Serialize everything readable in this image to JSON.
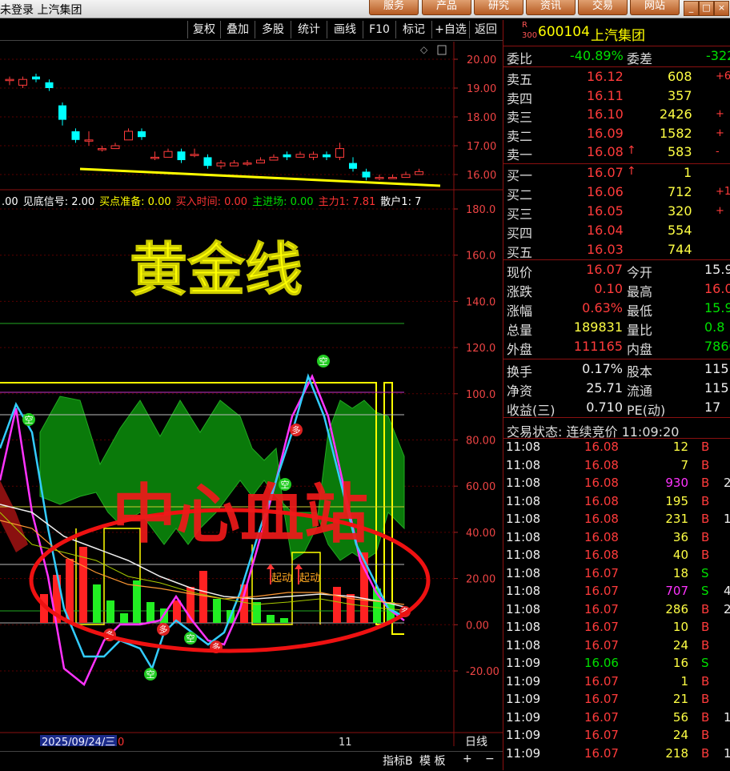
{
  "window": {
    "title": "未登录 上汽集团"
  },
  "menu": [
    "服务",
    "产品",
    "研究",
    "资讯",
    "交易",
    "网站"
  ],
  "win_controls": [
    "_",
    "□",
    "×"
  ],
  "toolbar": [
    "复权",
    "叠加",
    "多股",
    "统计",
    "画线",
    "F10",
    "标记",
    "+自选",
    "返回"
  ],
  "price_axis": [
    "20.00",
    "19.00",
    "18.00",
    "17.00",
    "16.00"
  ],
  "indicator_axis": [
    "180.0",
    "160.0",
    "140.0",
    "120.0",
    "100.0",
    "80.00",
    "60.00",
    "40.00",
    "20.00",
    "0.00",
    "-20.00"
  ],
  "indicator_params": [
    {
      "label": "见底信号: 2.00",
      "color": "#ffffff"
    },
    {
      "label": "买点准备: 0.00",
      "color": "#ffff00"
    },
    {
      "label": "买入时间: 0.00",
      "color": "#ff3333"
    },
    {
      "label": "主进场: 0.00",
      "color": "#00e000"
    },
    {
      "label": "主力1: 7.81",
      "color": "#ff3333"
    },
    {
      "label": "散户1: 7",
      "color": "#ffffff"
    }
  ],
  "indicator_params_prefix": ".00",
  "overlay": {
    "gold_line": "黄金线",
    "center": "中心血站"
  },
  "markers": {
    "kong": "空",
    "duo": "多",
    "qidong": "起动"
  },
  "date_label": "2025/09/24/三",
  "date_tail": "0",
  "axis_tick": "11",
  "period": "日线",
  "bottom_tabs": [
    "指标B",
    "模 板",
    "+",
    "−"
  ],
  "chart_data": {
    "type": "candlestick",
    "ylim": [
      15.5,
      20.5
    ],
    "candles": [
      {
        "o": 19.3,
        "c": 19.3,
        "h": 19.4,
        "l": 19.1
      },
      {
        "o": 19.1,
        "c": 19.3,
        "h": 19.4,
        "l": 19.0
      },
      {
        "o": 19.4,
        "c": 19.3,
        "h": 19.5,
        "l": 19.2
      },
      {
        "o": 19.2,
        "c": 19.0,
        "h": 19.3,
        "l": 18.9
      },
      {
        "o": 18.4,
        "c": 17.9,
        "h": 18.5,
        "l": 17.7
      },
      {
        "o": 17.5,
        "c": 17.2,
        "h": 17.6,
        "l": 17.1
      },
      {
        "o": 17.2,
        "c": 17.2,
        "h": 17.5,
        "l": 17.0
      },
      {
        "o": 16.9,
        "c": 16.9,
        "h": 17.0,
        "l": 16.8
      },
      {
        "o": 16.9,
        "c": 17.0,
        "h": 17.1,
        "l": 16.9
      },
      {
        "o": 17.2,
        "c": 17.5,
        "h": 17.6,
        "l": 17.2
      },
      {
        "o": 17.5,
        "c": 17.3,
        "h": 17.6,
        "l": 17.2
      },
      {
        "o": 16.6,
        "c": 16.6,
        "h": 16.8,
        "l": 16.5
      },
      {
        "o": 16.6,
        "c": 16.8,
        "h": 16.9,
        "l": 16.6
      },
      {
        "o": 16.8,
        "c": 16.5,
        "h": 16.9,
        "l": 16.4
      },
      {
        "o": 16.7,
        "c": 16.7,
        "h": 16.9,
        "l": 16.6
      },
      {
        "o": 16.6,
        "c": 16.3,
        "h": 16.7,
        "l": 16.2
      },
      {
        "o": 16.3,
        "c": 16.4,
        "h": 16.5,
        "l": 16.2
      },
      {
        "o": 16.3,
        "c": 16.4,
        "h": 16.5,
        "l": 16.3
      },
      {
        "o": 16.4,
        "c": 16.4,
        "h": 16.5,
        "l": 16.3
      },
      {
        "o": 16.4,
        "c": 16.5,
        "h": 16.6,
        "l": 16.4
      },
      {
        "o": 16.5,
        "c": 16.6,
        "h": 16.7,
        "l": 16.5
      },
      {
        "o": 16.7,
        "c": 16.6,
        "h": 16.8,
        "l": 16.5
      },
      {
        "o": 16.6,
        "c": 16.7,
        "h": 16.8,
        "l": 16.6
      },
      {
        "o": 16.6,
        "c": 16.7,
        "h": 16.8,
        "l": 16.5
      },
      {
        "o": 16.7,
        "c": 16.6,
        "h": 16.8,
        "l": 16.5
      },
      {
        "o": 16.6,
        "c": 16.9,
        "h": 17.1,
        "l": 16.5
      },
      {
        "o": 16.4,
        "c": 16.2,
        "h": 16.6,
        "l": 16.1
      },
      {
        "o": 16.1,
        "c": 15.9,
        "h": 16.2,
        "l": 15.8
      },
      {
        "o": 15.9,
        "c": 15.9,
        "h": 16.0,
        "l": 15.8
      },
      {
        "o": 15.9,
        "c": 15.9,
        "h": 16.0,
        "l": 15.85
      },
      {
        "o": 15.9,
        "c": 16.0,
        "h": 16.1,
        "l": 15.9
      },
      {
        "o": 16.0,
        "c": 16.1,
        "h": 16.2,
        "l": 16.0
      }
    ],
    "gold_line_value": [
      16.1,
      15.5
    ]
  },
  "stock": {
    "r": "R",
    "market": "300",
    "code": "600104",
    "name": "上汽集团"
  },
  "order_book": {
    "weibi_label": "委比",
    "weibi": "-40.89%",
    "weicha_label": "委差",
    "weicha": "-322",
    "asks": [
      {
        "label": "卖五",
        "price": "16.12",
        "vol": "608",
        "chg": "+6"
      },
      {
        "label": "卖四",
        "price": "16.11",
        "vol": "357",
        "chg": ""
      },
      {
        "label": "卖三",
        "price": "16.10",
        "vol": "2426",
        "chg": "+"
      },
      {
        "label": "卖二",
        "price": "16.09",
        "vol": "1582",
        "chg": "+"
      },
      {
        "label": "卖一",
        "price": "16.08",
        "vol": "583",
        "chg": "-",
        "arrow": "↑"
      }
    ],
    "bids": [
      {
        "label": "买一",
        "price": "16.07",
        "vol": "1",
        "chg": "",
        "arrow": "↑"
      },
      {
        "label": "买二",
        "price": "16.06",
        "vol": "712",
        "chg": "+1"
      },
      {
        "label": "买三",
        "price": "16.05",
        "vol": "320",
        "chg": "+"
      },
      {
        "label": "买四",
        "price": "16.04",
        "vol": "554",
        "chg": ""
      },
      {
        "label": "买五",
        "price": "16.03",
        "vol": "744",
        "chg": ""
      }
    ]
  },
  "quote": {
    "rows": [
      {
        "l1": "现价",
        "v1": "16.07",
        "l2": "今开",
        "v2": "15.9"
      },
      {
        "l1": "涨跌",
        "v1": "0.10",
        "l2": "最高",
        "v2": "16.0"
      },
      {
        "l1": "涨幅",
        "v1": "0.63%",
        "l2": "最低",
        "v2": "15.9"
      },
      {
        "l1": "总量",
        "v1": "189831",
        "l2": "量比",
        "v2": "0.8"
      },
      {
        "l1": "外盘",
        "v1": "111165",
        "l2": "内盘",
        "v2": "7860"
      }
    ],
    "rows2": [
      {
        "l1": "换手",
        "v1": "0.17%",
        "l2": "股本",
        "v2": "115"
      },
      {
        "l1": "净资",
        "v1": "25.71",
        "l2": "流通",
        "v2": "115"
      },
      {
        "l1": "收益(三)",
        "v1": "0.710",
        "l2": "PE(动)",
        "v2": "17"
      }
    ]
  },
  "trade_status": {
    "label": "交易状态: 连续竞价 11:09:20"
  },
  "trades": [
    {
      "t": "11:08",
      "p": "16.08",
      "v": "12",
      "d": "B",
      "x": ""
    },
    {
      "t": "11:08",
      "p": "16.08",
      "v": "7",
      "d": "B",
      "x": ""
    },
    {
      "t": "11:08",
      "p": "16.08",
      "v": "930",
      "d": "B",
      "x": "2"
    },
    {
      "t": "11:08",
      "p": "16.08",
      "v": "195",
      "d": "B",
      "x": ""
    },
    {
      "t": "11:08",
      "p": "16.08",
      "v": "231",
      "d": "B",
      "x": "1"
    },
    {
      "t": "11:08",
      "p": "16.08",
      "v": "36",
      "d": "B",
      "x": ""
    },
    {
      "t": "11:08",
      "p": "16.08",
      "v": "40",
      "d": "B",
      "x": ""
    },
    {
      "t": "11:08",
      "p": "16.07",
      "v": "18",
      "d": "S",
      "x": ""
    },
    {
      "t": "11:08",
      "p": "16.07",
      "v": "707",
      "d": "S",
      "x": "4"
    },
    {
      "t": "11:08",
      "p": "16.07",
      "v": "286",
      "d": "B",
      "x": "2"
    },
    {
      "t": "11:08",
      "p": "16.07",
      "v": "10",
      "d": "B",
      "x": ""
    },
    {
      "t": "11:08",
      "p": "16.07",
      "v": "24",
      "d": "B",
      "x": ""
    },
    {
      "t": "11:09",
      "p": "16.06",
      "v": "16",
      "d": "S",
      "x": ""
    },
    {
      "t": "11:09",
      "p": "16.07",
      "v": "1",
      "d": "B",
      "x": ""
    },
    {
      "t": "11:09",
      "p": "16.07",
      "v": "21",
      "d": "B",
      "x": ""
    },
    {
      "t": "11:09",
      "p": "16.07",
      "v": "56",
      "d": "B",
      "x": "1"
    },
    {
      "t": "11:09",
      "p": "16.07",
      "v": "24",
      "d": "B",
      "x": ""
    },
    {
      "t": "11:09",
      "p": "16.07",
      "v": "218",
      "d": "B",
      "x": "1"
    }
  ]
}
